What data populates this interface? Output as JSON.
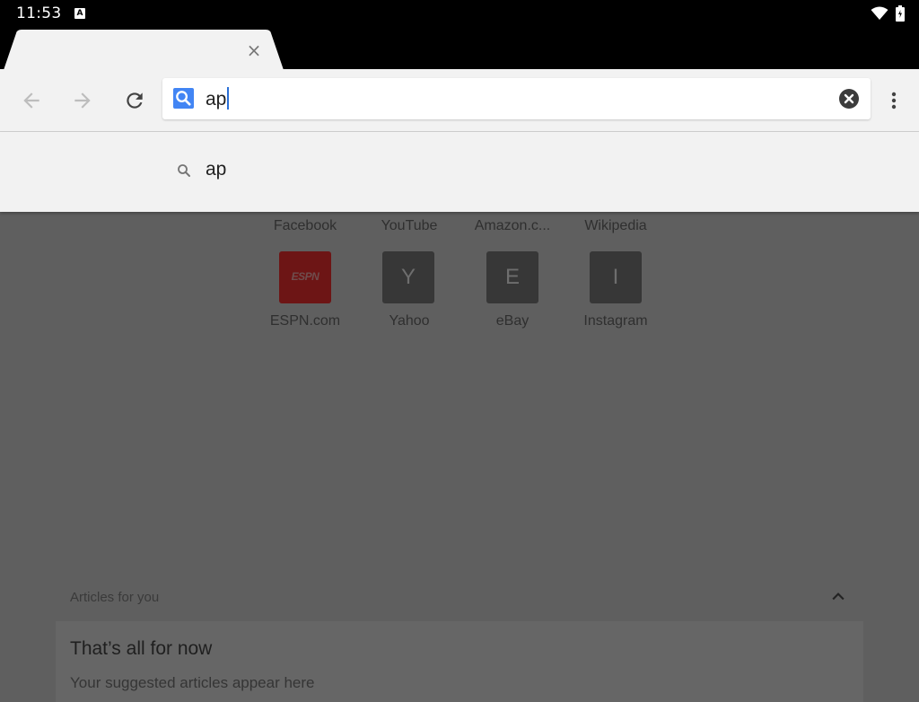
{
  "status_bar": {
    "time": "11:53",
    "keyboard_indicator": "A",
    "icons": [
      "wifi-icon",
      "battery-icon"
    ]
  },
  "tab": {
    "close_glyph": "×"
  },
  "toolbar": {
    "omnibox_text": "ap",
    "icons": [
      "back-arrow-icon",
      "forward-arrow-icon",
      "reload-icon",
      "search-icon",
      "clear-icon",
      "more-vert-icon"
    ]
  },
  "suggestions": [
    {
      "text": "ap",
      "icon": "search-icon"
    }
  ],
  "ntp": {
    "tiles_row1_labels": [
      "Facebook",
      "YouTube",
      "Amazon.c...",
      "Wikipedia"
    ],
    "tiles_row2": [
      {
        "label": "ESPN.com",
        "letter": "ESPN"
      },
      {
        "label": "Yahoo",
        "letter": "Y"
      },
      {
        "label": "eBay",
        "letter": "E"
      },
      {
        "label": "Instagram",
        "letter": "I"
      }
    ],
    "articles_header": "Articles for you",
    "card_title": "That’s all for now",
    "card_subtitle": "Your suggested articles appear here"
  },
  "colors": {
    "accent": "#4285f4",
    "scrim": "#5f5f5f",
    "toolbar": "#f2f2f2"
  }
}
